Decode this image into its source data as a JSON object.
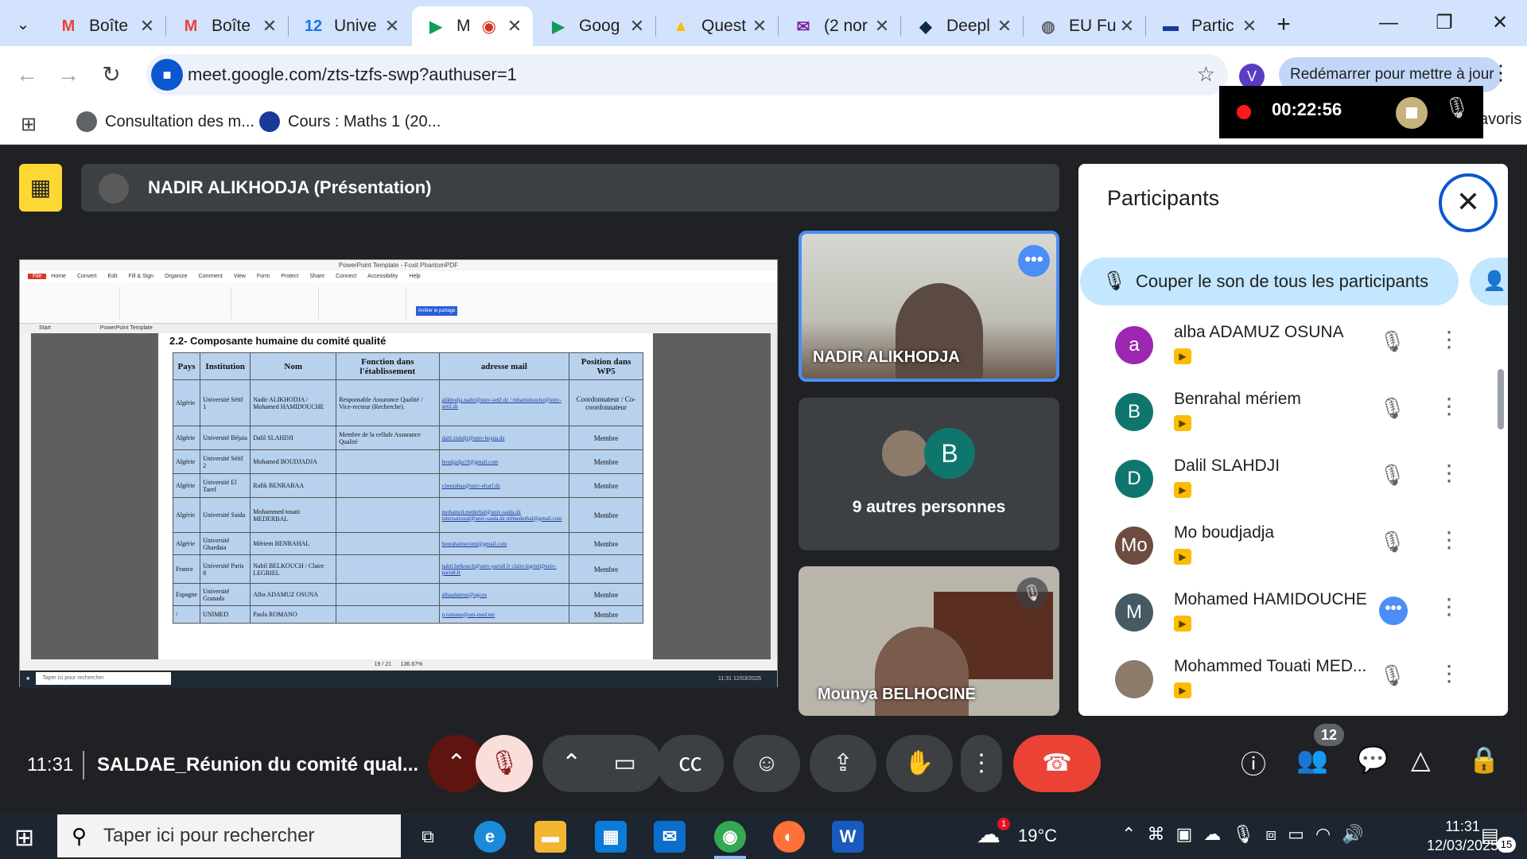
{
  "browser": {
    "tabs": [
      {
        "title": "Boîte",
        "favicon": "M",
        "color": "#ea4335",
        "active": false
      },
      {
        "title": "Boîte",
        "favicon": "M",
        "color": "#ea4335",
        "active": false
      },
      {
        "title": "Unive",
        "favicon": "12",
        "color": "#1a73e8",
        "active": false
      },
      {
        "title": "M",
        "favicon": "▶",
        "color": "#0f9d58",
        "active": true
      },
      {
        "title": "Goog",
        "favicon": "▶",
        "color": "#0f9d58",
        "active": false
      },
      {
        "title": "Quest",
        "favicon": "▲",
        "color": "#fbbc04",
        "active": false
      },
      {
        "title": "(2 nor",
        "favicon": "✉",
        "color": "#7b1fa2",
        "active": false
      },
      {
        "title": "Deepl",
        "favicon": "◆",
        "color": "#0f2b46",
        "active": false
      },
      {
        "title": "EU Fu",
        "favicon": "◍",
        "color": "#5f6368",
        "active": false
      },
      {
        "title": "Partic",
        "favicon": "▬",
        "color": "#1a3a9a",
        "active": false
      }
    ],
    "url": "meet.google.com/zts-tzfs-swp?authuser=1",
    "profile_initial": "V",
    "update_label": "Redémarrer pour mettre à jour",
    "bookmarks": [
      "Consultation des m...",
      "Cours : Maths 1 (20..."
    ],
    "bookmarks_overflow": "avoris"
  },
  "recording": {
    "elapsed": "00:22:56"
  },
  "meet": {
    "presenter_bar_name": "NADIR ALIKHODJA (Présentation)",
    "tiles": {
      "speaker_name": "NADIR ALIKHODJA",
      "others_label": "9 autres personnes",
      "others_initial": "B",
      "bottom_name": "Mounya BELHOCINE"
    },
    "shared_doc": {
      "window_title": "PowerPoint Template - Foxit PhantomPDF",
      "menu": [
        "File",
        "Home",
        "Convert",
        "Edit",
        "Fill & Sign",
        "Organize",
        "Comment",
        "View",
        "Form",
        "Protect",
        "Share",
        "Connect",
        "Accessibility",
        "Help"
      ],
      "share_button": "Arrêter le partage",
      "tabs": [
        "Start",
        "PowerPoint Template"
      ],
      "heading": "2.2-  Composante humaine du comité qualité",
      "columns": [
        "Pays",
        "Institution",
        "Nom",
        "Fonction dans l'établissement",
        "adresse mail",
        "Position dans WP5"
      ],
      "rows": [
        {
          "pays": "Algérie",
          "inst": "Université Sétif 1",
          "nom": "Nadir ALIKHODJA / Mohamed HAMIDOUCHE",
          "fonction": "Responsable Assurance Qualité / Vice-recteur (Recherche).",
          "mail": "alikhodja.nadir@univ-setif.dz / mhamidouche@univ-setif.dz",
          "pos": "Coordonnateur / Co-coordonnateur"
        },
        {
          "pays": "Algérie",
          "inst": "Université Béjaia",
          "nom": "Dalil SLAHDJI",
          "fonction": "Membre de la cellule Assurance Qualité",
          "mail": "dalil.slahdji@univ-bejaia.dz",
          "pos": "Membre"
        },
        {
          "pays": "Algérie",
          "inst": "Université Sétif 2",
          "nom": "Mohamed BOUDJADJA",
          "fonction": "",
          "mail": "boudjadja19@gmail.com",
          "pos": "Membre"
        },
        {
          "pays": "Algérie",
          "inst": "Université El Taref",
          "nom": "Rafik BENRABAA",
          "fonction": "",
          "mail": "r.benrabaa@univ-eltarf.dz",
          "pos": "Membre"
        },
        {
          "pays": "Algérie",
          "inst": "Université Saida",
          "nom": "Mohammed touati MEDERBAL",
          "fonction": "",
          "mail": "mohamed.mederbal@univ-saida.dz international@univ-saida.dz mfmederbal@gmail.com",
          "pos": "Membre"
        },
        {
          "pays": "Algérie",
          "inst": "Université Ghardaia",
          "nom": "Mériem BENRAHAL",
          "fonction": "",
          "mail": "benrahalmeriem@gmail.com",
          "pos": "Membre"
        },
        {
          "pays": "France",
          "inst": "Université Paris 8",
          "nom": "Nabil BELKOUCH / Claire LEGRIEL",
          "fonction": "",
          "mail": "nabil.belkouch@univ-paris8.fr claire.legriel@univ-paris8.fr",
          "pos": "Membre"
        },
        {
          "pays": "Espagne",
          "inst": "Université Granada",
          "nom": "Alba ADAMUZ OSUNA",
          "fonction": "",
          "mail": "albaadamuz@ugr.es",
          "pos": "Membre"
        },
        {
          "pays": "/",
          "inst": "UNIMED",
          "nom": "Paola ROMANO",
          "fonction": "",
          "mail": "p.romano@uni-med.net",
          "pos": "Membre"
        }
      ],
      "taskbar_search": "Taper ici pour rechercher",
      "page_indicator": "19 / 21",
      "zoom": "136.67%",
      "clock": "11:31",
      "date": "12/03/2025"
    },
    "panel": {
      "title": "Participants",
      "mute_all": "Couper le son de tous les participants",
      "participants": [
        {
          "name": "alba ADAMUZ OSUNA",
          "initial": "a",
          "color": "#9c27b0",
          "speaking": false
        },
        {
          "name": "Benrahal mériem",
          "initial": "B",
          "color": "#0f766e",
          "speaking": false
        },
        {
          "name": "Dalil SLAHDJI",
          "initial": "D",
          "color": "#0f766e",
          "speaking": false
        },
        {
          "name": "Mo boudjadja",
          "initial": "Mo",
          "color": "#6d4c41",
          "speaking": false
        },
        {
          "name": "Mohamed HAMIDOUCHE",
          "initial": "M",
          "color": "#455a64",
          "speaking": true
        },
        {
          "name": "Mohammed Touati MED...",
          "initial": "",
          "color": "#8c7a6b",
          "speaking": false
        }
      ]
    },
    "controls": {
      "time": "11:31",
      "meeting_title": "SALDAE_Réunion du comité qual...",
      "participant_count": "12"
    }
  },
  "taskbar": {
    "search_placeholder": "Taper ici pour rechercher",
    "weather_temp": "19°C",
    "weather_alert": "1",
    "time": "11:31",
    "date": "12/03/2025",
    "notif_count": "15"
  }
}
